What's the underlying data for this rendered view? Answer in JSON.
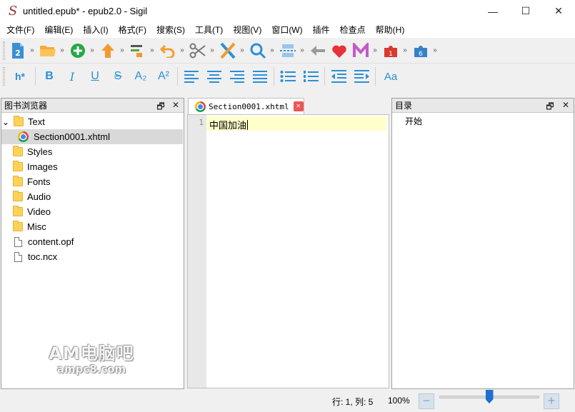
{
  "window": {
    "title": "untitled.epub* - epub2.0 - Sigil",
    "minimize": "—",
    "maximize": "☐",
    "close": "✕"
  },
  "menu": [
    "文件(F)",
    "编辑(E)",
    "插入(I)",
    "格式(F)",
    "搜索(S)",
    "工具(T)",
    "视图(V)",
    "窗口(W)",
    "插件",
    "检查点",
    "帮助(H)"
  ],
  "toolbar": {
    "more": "»",
    "heading_label": "h*",
    "bold": "B",
    "italic": "I",
    "underline": "U",
    "strike": "S",
    "subscript": "A₂",
    "superscript": "A²",
    "case_label": "Aa",
    "new_badge": "2",
    "plugin1_badge": "1",
    "plugin2_badge": "6"
  },
  "book_browser": {
    "title": "图书浏览器",
    "float": "🗗",
    "close": "✕",
    "items": [
      {
        "label": "Text",
        "type": "folder",
        "expanded": true
      },
      {
        "label": "Section0001.xhtml",
        "type": "html"
      },
      {
        "label": "Styles",
        "type": "folder"
      },
      {
        "label": "Images",
        "type": "folder"
      },
      {
        "label": "Fonts",
        "type": "folder"
      },
      {
        "label": "Audio",
        "type": "folder"
      },
      {
        "label": "Video",
        "type": "folder"
      },
      {
        "label": "Misc",
        "type": "folder"
      },
      {
        "label": "content.opf",
        "type": "file"
      },
      {
        "label": "toc.ncx",
        "type": "file"
      }
    ],
    "expander": "⌄"
  },
  "editor": {
    "tab_label": "Section0001.xhtml",
    "tab_close": "✕",
    "line_number": "1",
    "content": "中国加油"
  },
  "toc": {
    "title": "目录",
    "float": "🗗",
    "close": "✕",
    "entries": [
      "开始"
    ]
  },
  "status": {
    "position": "行: 1, 列: 5",
    "zoom": "100%",
    "zoom_out": "−",
    "zoom_in": "+",
    "zoom_level": 0.5
  },
  "watermark": {
    "line1": "AM电脑吧",
    "line2": "ampc8.com"
  },
  "colors": {
    "accent": "#2b8fd6",
    "selection": "#d9d9d9",
    "current_line": "#ffffcc"
  }
}
